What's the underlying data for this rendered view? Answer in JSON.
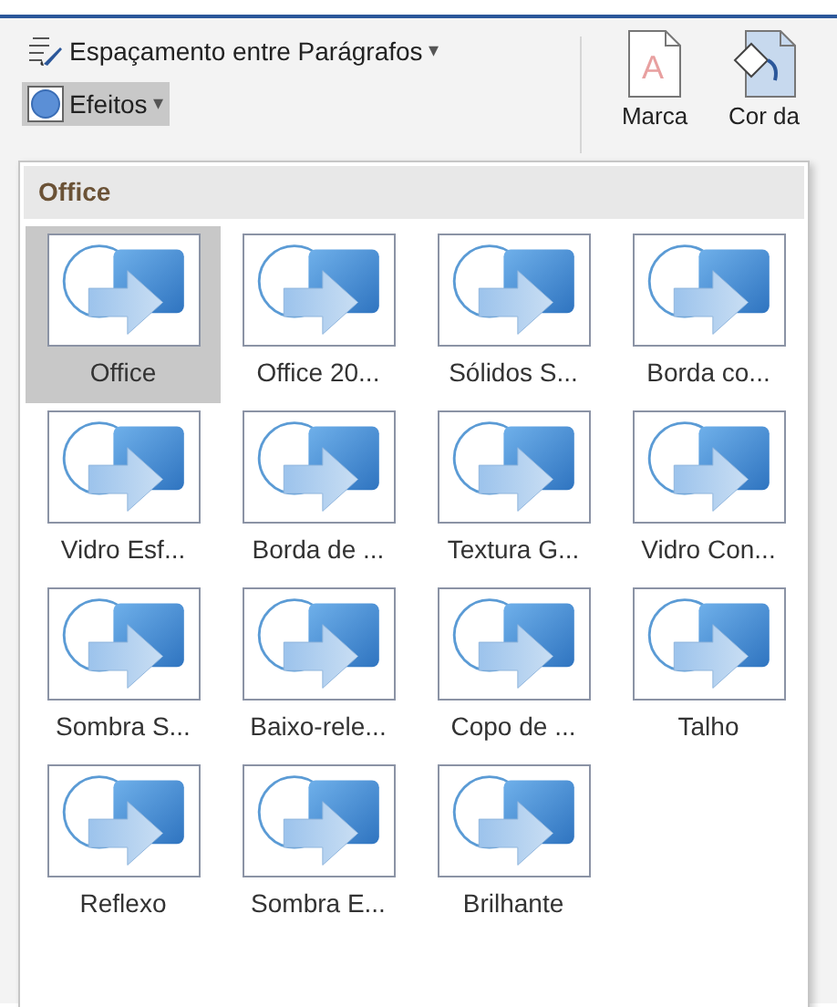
{
  "ribbon": {
    "paragraph_spacing": {
      "label": "Espaçamento entre Parágrafos",
      "caret": "▾"
    },
    "effects": {
      "label": "Efeitos",
      "caret": "▾",
      "selected": true
    },
    "watermark": {
      "glyph": "A",
      "label": "Marca"
    },
    "page_color": {
      "label": "Cor da"
    }
  },
  "gallery": {
    "header": "Office",
    "items": [
      {
        "label": "Office",
        "selected": true
      },
      {
        "label": "Office 20...",
        "selected": false
      },
      {
        "label": "Sólidos S...",
        "selected": false
      },
      {
        "label": "Borda co...",
        "selected": false
      },
      {
        "label": "Vidro Esf...",
        "selected": false
      },
      {
        "label": "Borda de ...",
        "selected": false
      },
      {
        "label": "Textura G...",
        "selected": false
      },
      {
        "label": "Vidro Con...",
        "selected": false
      },
      {
        "label": "Sombra S...",
        "selected": false
      },
      {
        "label": "Baixo-rele...",
        "selected": false
      },
      {
        "label": "Copo de ...",
        "selected": false
      },
      {
        "label": "Talho",
        "selected": false
      },
      {
        "label": "Reflexo",
        "selected": false
      },
      {
        "label": "Sombra E...",
        "selected": false
      },
      {
        "label": "Brilhante",
        "selected": false
      }
    ]
  }
}
